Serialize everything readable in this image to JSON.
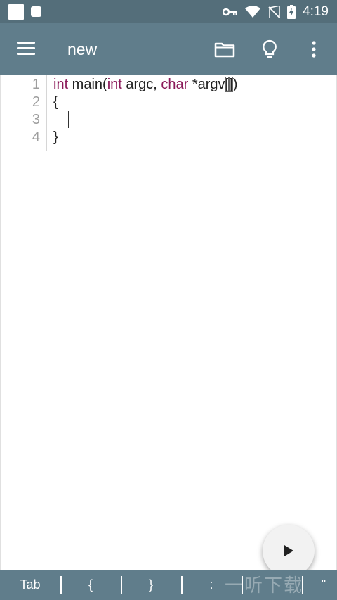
{
  "status_bar": {
    "time": "4:19",
    "icons": [
      "notification-square-icon",
      "notification-small-icon",
      "vpn-key-icon",
      "wifi-icon",
      "no-sim-icon",
      "battery-charging-icon"
    ]
  },
  "app_bar": {
    "title": "new",
    "icons": [
      "menu-icon",
      "folder-icon",
      "lightbulb-icon",
      "more-vert-icon"
    ]
  },
  "editor": {
    "line_numbers": [
      "1",
      "2",
      "3",
      "4"
    ],
    "lines": [
      {
        "kw1": "int",
        "t1": " main(",
        "kw2": "int",
        "t2": " argc, ",
        "kw3": "char",
        "t3": " *argv",
        "b1": "[",
        "b2": "]",
        "t4": ")"
      },
      {
        "text": "{"
      },
      {
        "text": ""
      },
      {
        "text": "}"
      }
    ],
    "keyword_color": "#8b1a5a"
  },
  "fab": {
    "icon": "play-icon"
  },
  "symbol_bar": {
    "keys": [
      "Tab",
      "{",
      "}",
      ":",
      "\""
    ]
  },
  "watermark": "一听下载",
  "colors": {
    "status_bar": "#546e7a",
    "app_bar": "#607d8b",
    "symbol_bar": "#607d8b"
  }
}
